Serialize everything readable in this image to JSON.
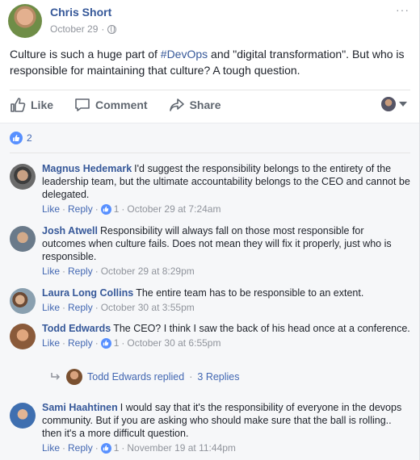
{
  "post": {
    "author": "Chris Short",
    "date": "October 29",
    "dot": "·",
    "more": "···",
    "text_before": "Culture is such a huge part of ",
    "hashtag": "#DevOps",
    "text_after": " and \"digital transformation\". But who is responsible for maintaining that culture? A tough question."
  },
  "actions": {
    "like": "Like",
    "comment": "Comment",
    "share": "Share"
  },
  "reactions": {
    "count": "2"
  },
  "footer_labels": {
    "like": "Like",
    "reply": "Reply",
    "dot": "·"
  },
  "comments": [
    {
      "name": "Magnus Hedemark",
      "text": "I'd suggest the responsibility belongs to the entirety of the leadership team, but the ultimate accountability belongs to the CEO and cannot be delegated.",
      "likes": "1",
      "time": "October 29 at 7:24am"
    },
    {
      "name": "Josh Atwell",
      "text": "Responsibility will always fall on those most responsible for outcomes when culture fails. Does not mean they will fix it properly, just who is responsible.",
      "likes": "",
      "time": "October 29 at 8:29pm"
    },
    {
      "name": "Laura Long Collins",
      "text": "The entire team has to be responsible to an extent.",
      "likes": "",
      "time": "October 30 at 3:55pm"
    },
    {
      "name": "Todd Edwards",
      "text": "The CEO? I think I saw the back of his head once at a conference.",
      "likes": "1",
      "time": "October 30 at 6:55pm"
    },
    {
      "name": "Sami Haahtinen",
      "text": "I would say that it's the responsibility of everyone in the devops community. But if you are asking who should make sure that the ball is rolling.. then it's a more difficult question.",
      "likes": "1",
      "time": "November 19 at 11:44pm"
    }
  ],
  "replies": {
    "text": "Todd Edwards replied",
    "dot": "·",
    "count": "3 Replies"
  },
  "colors": {
    "link_blue": "#365899",
    "action_blue": "#4267b2",
    "like_blue": "#5890ff",
    "muted": "#90949c",
    "comments_bg": "#f6f7f9"
  },
  "icons": {
    "like": "thumbs-up-icon",
    "comment": "speech-bubble-icon",
    "share": "share-arrow-icon",
    "privacy": "globe-icon"
  }
}
